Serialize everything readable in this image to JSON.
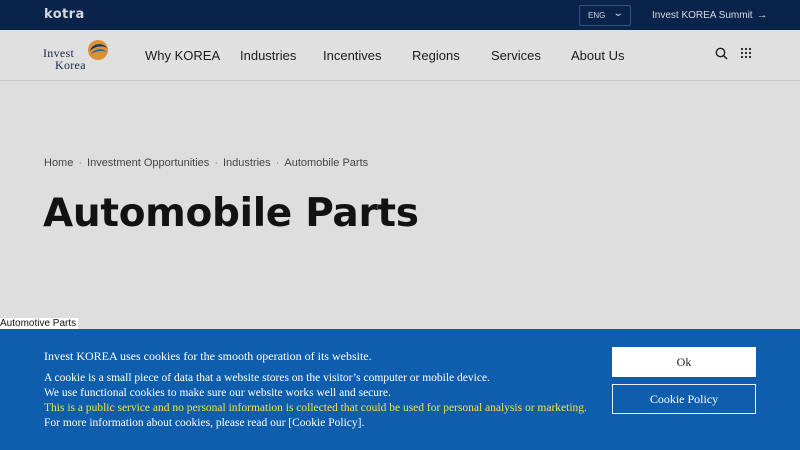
{
  "topbar": {
    "brand": "kotra",
    "language": "ENG",
    "summit_link": "Invest KOREA Summit"
  },
  "logo": {
    "line1": "Invest",
    "line2": "Korea"
  },
  "nav": {
    "items": [
      "Why KOREA",
      "Industries",
      "Incentives",
      "Regions",
      "Services",
      "About Us"
    ]
  },
  "hero": {
    "breadcrumb": [
      "Home",
      "Investment Opportunities",
      "Industries",
      "Automobile Parts"
    ],
    "title": "Automobile Parts"
  },
  "page_caption": "Automotive Parts",
  "cookie": {
    "heading": "Invest KOREA uses cookies for the smooth operation of its website.",
    "lines": [
      "A cookie is a small piece of data that a website stores on the visitor’s computer or mobile device.",
      "We use functional cookies to make sure our website works well and secure.",
      "This is a public service and no personal information is collected that could be used for personal analysis or marketing.",
      "For more information about cookies, please read our [Cookie Policy]."
    ],
    "ok_label": "Ok",
    "policy_label": "Cookie Policy",
    "colors": {
      "banner": "#0e5ead",
      "highlight": "#f5e04a"
    }
  },
  "colors": {
    "topbar": "#0c2753"
  }
}
